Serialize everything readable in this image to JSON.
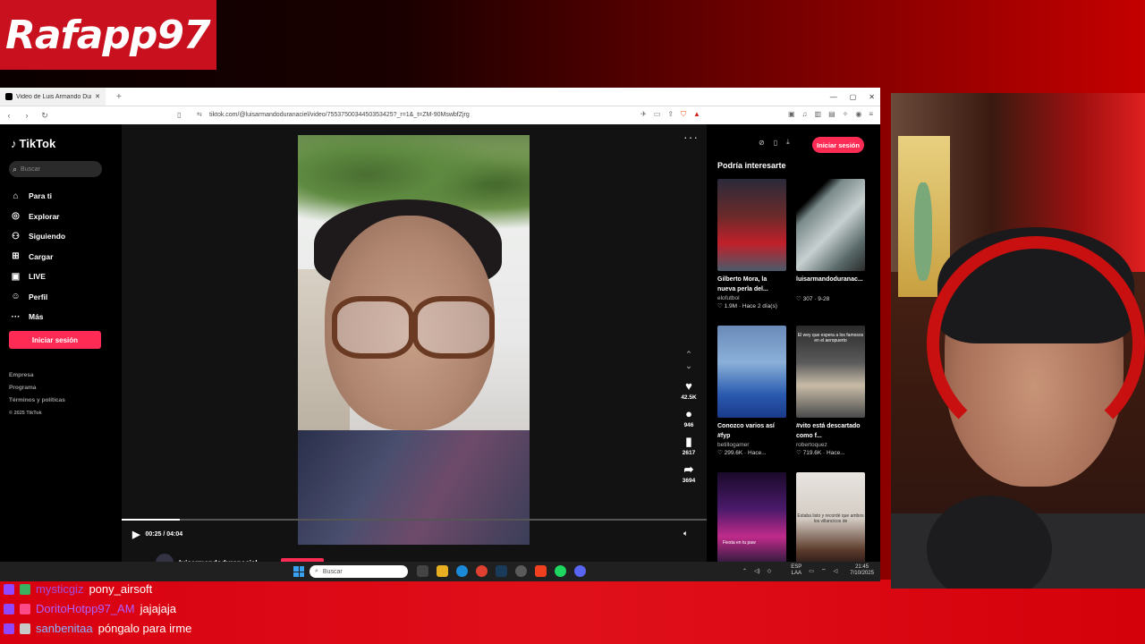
{
  "overlay": {
    "channel_logo": "Rafapp97"
  },
  "browser": {
    "tab_title": "Video de Luis Armando Duran N",
    "url": "tiktok.com/@luisarmandoduranaciel/video/7553750034450353425?_r=1&_t=ZM-90MswbfZjrg"
  },
  "tiktok": {
    "brand": "TikTok",
    "search_placeholder": "Buscar",
    "menu": [
      {
        "icon": "home-icon",
        "label": "Para ti"
      },
      {
        "icon": "compass-icon",
        "label": "Explorar"
      },
      {
        "icon": "user-follow-icon",
        "label": "Siguiendo"
      },
      {
        "icon": "upload-icon",
        "label": "Cargar"
      },
      {
        "icon": "live-icon",
        "label": "LIVE"
      },
      {
        "icon": "profile-icon",
        "label": "Perfil"
      },
      {
        "icon": "more-icon",
        "label": "Más"
      }
    ],
    "login_button": "Iniciar sesión",
    "footer": [
      "Empresa",
      "Programa",
      "Términos y políticas",
      "© 2025 TikTok"
    ],
    "video": {
      "likes": "42.5K",
      "comments": "946",
      "saves": "2617",
      "shares": "3694",
      "time": "00:25 / 04:04",
      "progress_fraction": 0.1,
      "author": "luisarmandoduranaciel"
    },
    "right_panel": {
      "login_button": "Iniciar sesión",
      "heading": "Podría interesarte",
      "cards": [
        {
          "title": "Gilberto Mora, la nueva perla del...",
          "user": "elofutbol",
          "meta": "♡ 1.9M · Hace 2 día(s)",
          "thumb_caption": ""
        },
        {
          "title": "luisarmandoduranac...",
          "user": "",
          "meta": "♡ 307 · 9-28",
          "thumb_caption": ""
        },
        {
          "title": "Conozco varios así #fyp",
          "user": "betillogamer",
          "meta": "♡ 299.6K · Hace...",
          "thumb_caption": ""
        },
        {
          "title": "#vito está descartado como f...",
          "user": "robertoquez",
          "meta": "♡ 719.6K · Hace...",
          "thumb_caption": "El wey que espera a los famosos en el aeropuerto"
        },
        {
          "title": "",
          "user": "",
          "meta": "",
          "thumb_caption": "Fiesta en tu paw"
        },
        {
          "title": "",
          "user": "",
          "meta": "",
          "thumb_caption": "Estaba listo y recordé que ambos los villancicos de"
        }
      ]
    }
  },
  "taskbar": {
    "search_placeholder": "Buscar",
    "lang_top": "ESP",
    "lang_bottom": "LAA",
    "time": "21:45",
    "date": "7/10/2025"
  },
  "chat": [
    {
      "user": "mysticgiz",
      "message": "pony_airsoft",
      "color": "#a050e0"
    },
    {
      "user": "DoritoHotpp97_AM",
      "message": "jajajaja",
      "color": "#b060ff"
    },
    {
      "user": "sanbenitaa",
      "message": "póngalo para irme",
      "color": "#8ab4ff"
    }
  ]
}
